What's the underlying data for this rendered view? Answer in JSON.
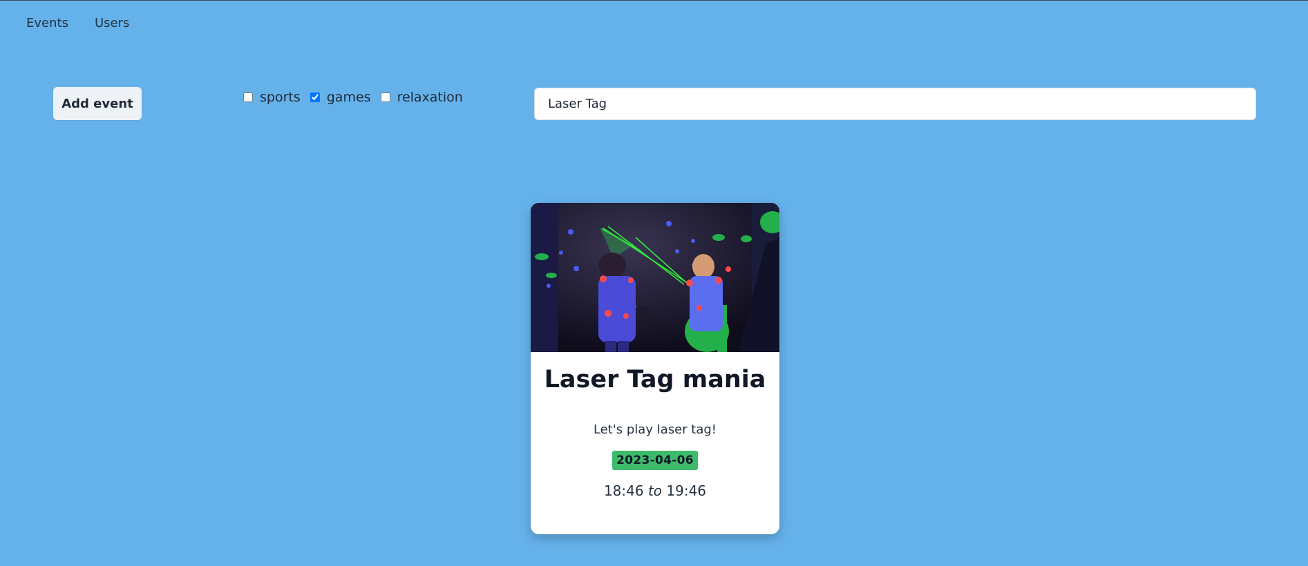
{
  "nav": {
    "events_label": "Events",
    "users_label": "Users"
  },
  "toolbar": {
    "add_event_label": "Add event"
  },
  "filters": [
    {
      "label": "sports",
      "checked": false
    },
    {
      "label": "games",
      "checked": true
    },
    {
      "label": "relaxation",
      "checked": false
    }
  ],
  "search": {
    "value": "Laser Tag"
  },
  "event_card": {
    "title": "Laser Tag mania",
    "description": "Let's play laser tag!",
    "date": "2023-04-06",
    "start_time": "18:46",
    "to_word": "to",
    "end_time": "19:46",
    "image_icon": "laser-tag-photo"
  },
  "colors": {
    "background": "#65b2eb",
    "date_badge": "#3dbb6b"
  }
}
